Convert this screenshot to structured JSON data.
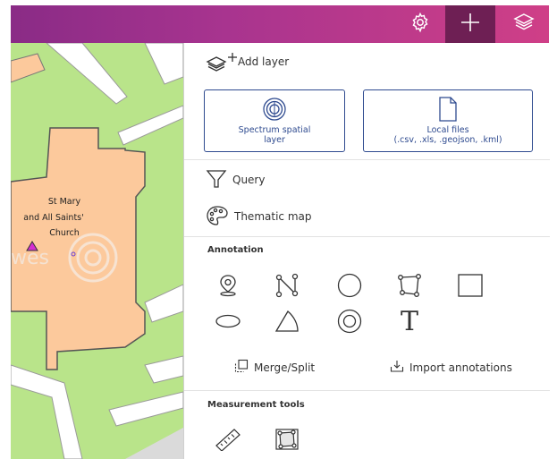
{
  "header": {
    "icons": [
      "gear-icon",
      "plus-icon",
      "layers-icon"
    ],
    "colors": {
      "gradient_start": "#8a2b86",
      "gradient_end": "#cf3f87",
      "active_button": "#6e1f54"
    }
  },
  "map": {
    "building_label_line1": "St Mary",
    "building_label_line2": "and All Saints'",
    "building_label_line3": "Church",
    "watermark_text": "wes",
    "colors": {
      "grass": "#b9e48a",
      "building": "#fcc99c",
      "road": "#ffffff"
    }
  },
  "panel": {
    "add_layer": {
      "label": "Add layer",
      "icon": "add-layers-icon"
    },
    "cards": [
      {
        "line1": "Spectrum spatial",
        "line2": "layer",
        "icon": "spectrum-icon"
      },
      {
        "line1": "Local files",
        "line2": "(.csv, .xls, .geojson, .kml)",
        "icon": "file-icon"
      }
    ],
    "query": {
      "label": "Query",
      "icon": "funnel-icon"
    },
    "thematic": {
      "label": "Thematic map",
      "icon": "palette-icon"
    },
    "annotation": {
      "title": "Annotation",
      "tools": [
        "marker-icon",
        "polyline-icon",
        "circle-icon",
        "polygon-icon",
        "rectangle-icon",
        "ellipse-icon",
        "sector-icon",
        "ring-icon",
        "text-icon"
      ],
      "text_tool_glyph": "T",
      "merge_split": "Merge/Split",
      "import": "Import annotations"
    },
    "measurement": {
      "title": "Measurement tools",
      "tools": [
        "ruler-icon",
        "area-measure-icon"
      ]
    }
  }
}
